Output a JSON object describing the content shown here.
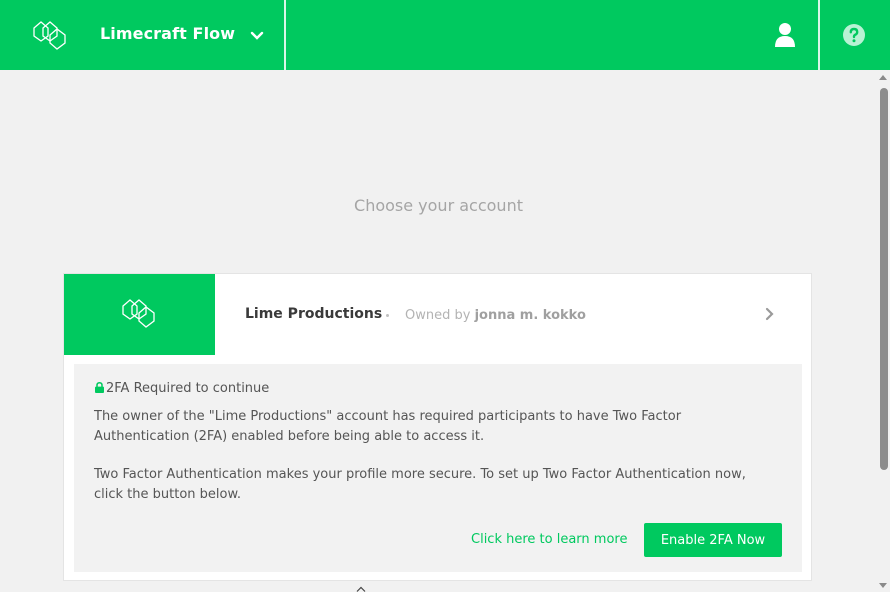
{
  "header": {
    "app_title": "Limecraft Flow",
    "brand_color": "#00c95f",
    "icons": [
      "cubes-logo-icon",
      "chevron-down-icon",
      "user-icon",
      "help-circle-icon"
    ]
  },
  "main": {
    "heading": "Choose your account"
  },
  "account": {
    "name": "Lime Productions",
    "owned_by_label": "Owned by",
    "owner": "jonna m. kokko"
  },
  "notice": {
    "required": "2FA Required to continue",
    "paragraph1": "The owner of the \"Lime Productions\" account has required participants to have Two Factor Authentication (2FA) enabled before being able to access it.",
    "paragraph2": "Two Factor Authentication makes your profile more secure. To set up Two Factor Authentication now, click the button below.",
    "learn_more": "Click here to learn more",
    "enable_button": "Enable 2FA Now"
  }
}
